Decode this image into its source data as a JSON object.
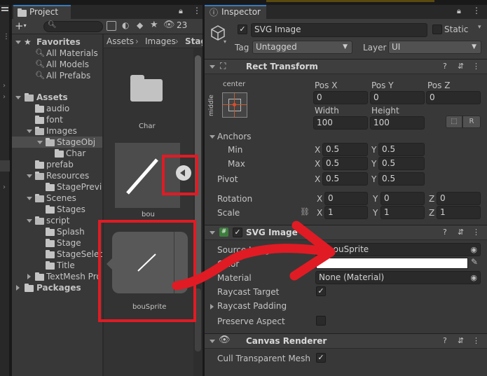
{
  "project_tab": {
    "title": "Project",
    "hidden_count": "23",
    "search_placeholder": ""
  },
  "favorites": {
    "title": "Favorites",
    "items": [
      "All Materials",
      "All Models",
      "All Prefabs"
    ]
  },
  "tree": {
    "assets": "Assets",
    "items": [
      "audio",
      "font",
      "Images",
      "StageObj",
      "Char",
      "prefab",
      "Resources",
      "StagePrevie",
      "Scenes",
      "Stages",
      "script",
      "Splash",
      "Stage",
      "StageSelec",
      "Title",
      "TextMesh Pro"
    ],
    "packages": "Packages"
  },
  "breadcrumb": {
    "items": [
      "Assets",
      "Images",
      "Stag"
    ]
  },
  "grid": {
    "items": [
      "Char",
      "bou",
      "bouSprite"
    ]
  },
  "inspector": {
    "tab_title": "Inspector",
    "object_name": "SVG Image",
    "static_label": "Static",
    "tag_label": "Tag",
    "tag_value": "Untagged",
    "layer_label": "Layer",
    "layer_value": "UI"
  },
  "rect_transform": {
    "title": "Rect Transform",
    "anchor_h": "center",
    "anchor_v": "middle",
    "pos_x_label": "Pos X",
    "pos_y_label": "Pos Y",
    "pos_z_label": "Pos Z",
    "pos_x": "0",
    "pos_y": "0",
    "pos_z": "0",
    "width_label": "Width",
    "height_label": "Height",
    "width": "100",
    "height": "100",
    "blueprint_btn": "⬚",
    "raw_btn": "R",
    "anchors_label": "Anchors",
    "min_label": "Min",
    "max_label": "Max",
    "min_x": "0.5",
    "min_y": "0.5",
    "max_x": "0.5",
    "max_y": "0.5",
    "pivot_label": "Pivot",
    "pivot_x": "0.5",
    "pivot_y": "0.5",
    "rotation_label": "Rotation",
    "rot_x": "0",
    "rot_y": "0",
    "rot_z": "0",
    "scale_label": "Scale",
    "scale_x": "1",
    "scale_y": "1",
    "scale_z": "1",
    "axis_x": "X",
    "axis_y": "Y",
    "axis_z": "Z"
  },
  "svg_image": {
    "title": "SVG Image",
    "source_label": "Source Image",
    "source_value": "bouSprite",
    "color_label": "Color",
    "material_label": "Material",
    "material_value": "None (Material)",
    "raycast_target_label": "Raycast Target",
    "raycast_padding_label": "Raycast Padding",
    "preserve_aspect_label": "Preserve Aspect"
  },
  "canvas_renderer": {
    "title": "Canvas Renderer",
    "cull_label": "Cull Transparent Mesh"
  },
  "colors": {
    "annotation_red": "#e01b24",
    "panel_bg": "#383838",
    "field_bg": "#2a2a2a",
    "selection": "#4d4d4d"
  }
}
